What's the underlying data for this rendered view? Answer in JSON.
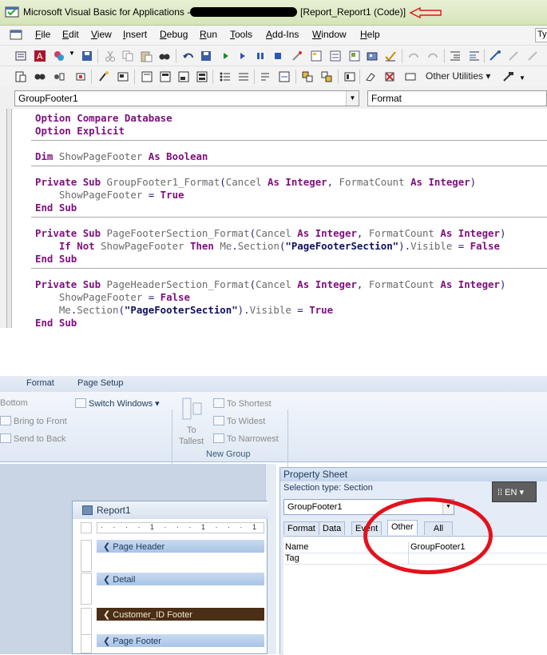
{
  "vba": {
    "title_prefix": "Microsoft Visual Basic for Applications -",
    "title_suffix": "[Report_Report1 (Code)]",
    "menu": [
      {
        "label": "File",
        "u": "F"
      },
      {
        "label": "Edit",
        "u": "E"
      },
      {
        "label": "View",
        "u": "V"
      },
      {
        "label": "Insert",
        "u": "I"
      },
      {
        "label": "Debug",
        "u": "D"
      },
      {
        "label": "Run",
        "u": "R"
      },
      {
        "label": "Tools",
        "u": "T"
      },
      {
        "label": "Add-Ins",
        "u": "A"
      },
      {
        "label": "Window",
        "u": "W"
      },
      {
        "label": "Help",
        "u": "H"
      }
    ],
    "other_utilities_label": "Other Utilities ▾",
    "object_combo": "GroupFooter1",
    "procedure_combo": "Format",
    "code": [
      "Option Compare Database",
      "Option Explicit",
      "Dim ShowPageFooter As Boolean",
      "Private Sub GroupFooter1_Format(Cancel As Integer, FormatCount As Integer)",
      "    ShowPageFooter = True",
      "End Sub",
      "Private Sub PageFooterSection_Format(Cancel As Integer, FormatCount As Integer)",
      "    If Not ShowPageFooter Then Me.Section(\"PageFooterSection\").Visible = False",
      "End Sub",
      "Private Sub PageHeaderSection_Format(Cancel As Integer, FormatCount As Integer)",
      "    ShowPageFooter = False",
      "    Me.Section(\"PageFooterSection\").Visible = True",
      "End Sub"
    ]
  },
  "access": {
    "ribbon_tabs": [
      "Format",
      "Page Setup"
    ],
    "ribbon": {
      "bottom": "Bottom",
      "bring_to_front": "Bring to Front",
      "send_to_back": "Send to Back",
      "switch_windows": "Switch Windows ▾",
      "to_tallest_1": "To",
      "to_tallest_2": "Tallest",
      "to_shortest": "To Shortest",
      "to_widest": "To Widest",
      "to_narrowest": "To Narrowest",
      "group_label": "New Group"
    },
    "report": {
      "title": "Report1",
      "ruler": "· · · · 1 · · · 1 · · · 1 · · · 2 ·",
      "sections": [
        "Page Header",
        "Detail",
        "Customer_ID Footer",
        "Page Footer"
      ]
    },
    "property_sheet": {
      "title": "Property Sheet",
      "selection_type": "Selection type:  Section",
      "combo": "GroupFooter1",
      "tabs": [
        "Format",
        "Data",
        "Event",
        "Other",
        "All"
      ],
      "active_tab": "Other",
      "rows": [
        {
          "name": "Name",
          "value": "GroupFooter1"
        },
        {
          "name": "Tag",
          "value": ""
        }
      ]
    },
    "language_badge": "EN"
  },
  "colors": {
    "annotation_red": "#e3121d",
    "keyword": "#7d0f7d",
    "footer_section": "#4b2e16"
  }
}
